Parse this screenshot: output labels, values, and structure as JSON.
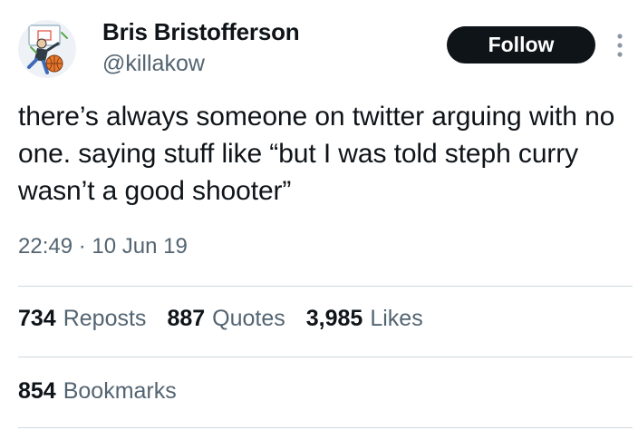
{
  "author": {
    "display_name": "Bris Bristofferson",
    "handle": "@killakow",
    "avatar_icon": "cartoon-basketball-avatar"
  },
  "actions": {
    "follow_label": "Follow",
    "more_icon": "more-vertical-icon"
  },
  "tweet": {
    "text": "there’s always someone on twitter arguing with no one. saying stuff like “but I was told steph curry wasn’t a good shooter”",
    "timestamp": "22:49 · 10 Jun 19"
  },
  "stats": {
    "reposts": {
      "count": "734",
      "label": "Reposts"
    },
    "quotes": {
      "count": "887",
      "label": "Quotes"
    },
    "likes": {
      "count": "3,985",
      "label": "Likes"
    },
    "bookmarks": {
      "count": "854",
      "label": "Bookmarks"
    }
  },
  "colors": {
    "text_primary": "#0f1419",
    "text_secondary": "#536471",
    "divider": "#cfd9de",
    "button_bg": "#0f1419"
  }
}
